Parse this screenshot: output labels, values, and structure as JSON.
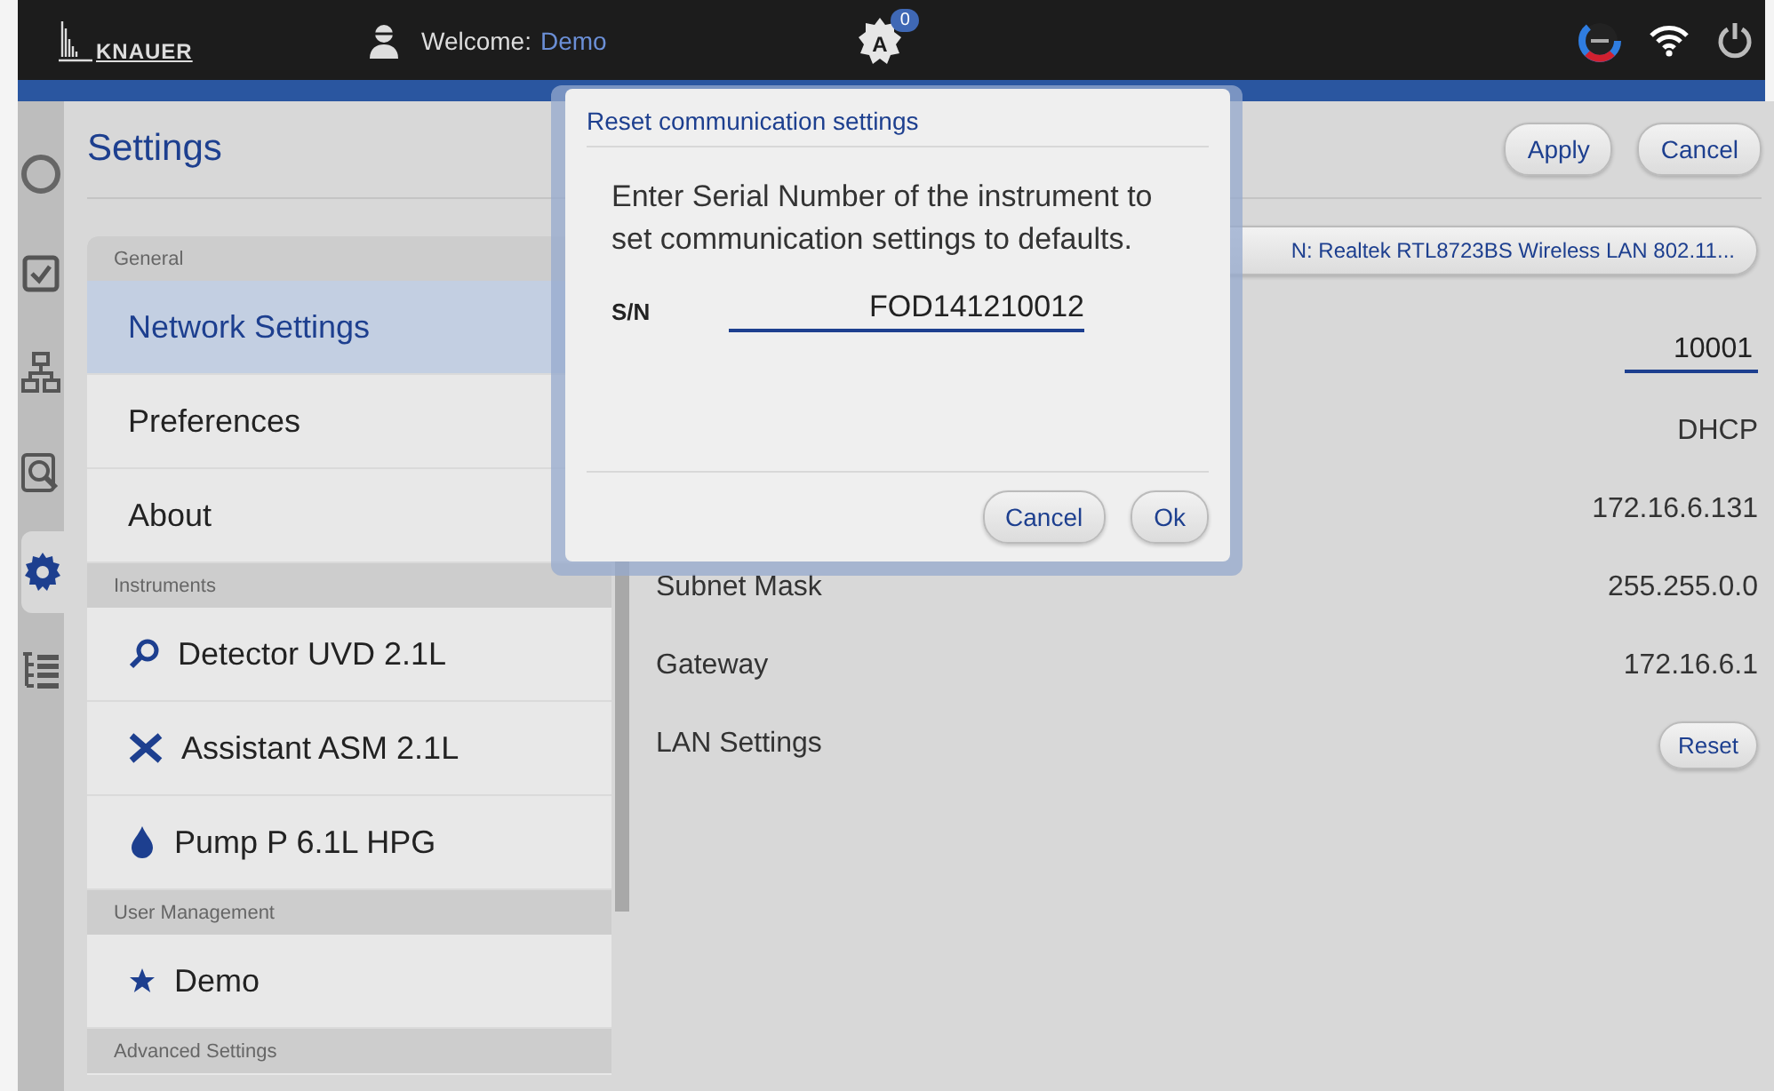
{
  "top_bar": {
    "brand": "KNAUER",
    "welcome_label": "Welcome:",
    "user": "Demo",
    "notification_count": "0",
    "auto_letter": "A"
  },
  "nav_rail": [
    {
      "kind": "spinner",
      "selected": false
    },
    {
      "kind": "checklist",
      "selected": false
    },
    {
      "kind": "hierarchy",
      "selected": false
    },
    {
      "kind": "document-search",
      "selected": false
    },
    {
      "kind": "gear",
      "selected": true
    },
    {
      "kind": "list-tree",
      "selected": false
    }
  ],
  "page": {
    "title": "Settings",
    "buttons": [
      "Apply",
      "Cancel"
    ]
  },
  "sidebar": {
    "groups": [
      {
        "heading": "General",
        "items": [
          {
            "label": "Network Settings",
            "kind": "plain",
            "selected": true
          },
          {
            "label": "Preferences",
            "kind": "plain",
            "selected": false
          },
          {
            "label": "About",
            "kind": "plain",
            "selected": false
          }
        ]
      },
      {
        "heading": "Instruments",
        "items": [
          {
            "label": "Detector UVD 2.1L",
            "kind": "detector",
            "selected": false
          },
          {
            "label": "Assistant ASM 2.1L",
            "kind": "tools",
            "selected": false
          },
          {
            "label": "Pump P 6.1L HPG",
            "kind": "pump",
            "selected": false
          }
        ]
      },
      {
        "heading": "User Management",
        "items": [
          {
            "label": "Demo",
            "kind": "user",
            "selected": false
          }
        ]
      },
      {
        "heading": "Advanced Settings"
      }
    ]
  },
  "network": {
    "interface": "N: Realtek RTL8723BS Wireless LAN 802.11...",
    "rows": [
      {
        "kind": "field",
        "value": "10001"
      },
      {
        "kind": "text",
        "value": "DHCP"
      },
      {
        "kind": "text",
        "value": "172.16.6.131"
      },
      {
        "kind": "text",
        "label": "Subnet Mask",
        "value": "255.255.0.0"
      },
      {
        "kind": "text",
        "label": "Gateway",
        "value": "172.16.6.1"
      },
      {
        "kind": "button",
        "label": "LAN Settings",
        "value": "Reset"
      }
    ]
  },
  "dialog": {
    "title": "Reset communication settings",
    "message": "Enter Serial Number of the instrument to set communication settings to defaults.",
    "field_label": "S/N",
    "serial": "FOD141210012",
    "buttons": [
      "Cancel",
      "Ok"
    ]
  }
}
